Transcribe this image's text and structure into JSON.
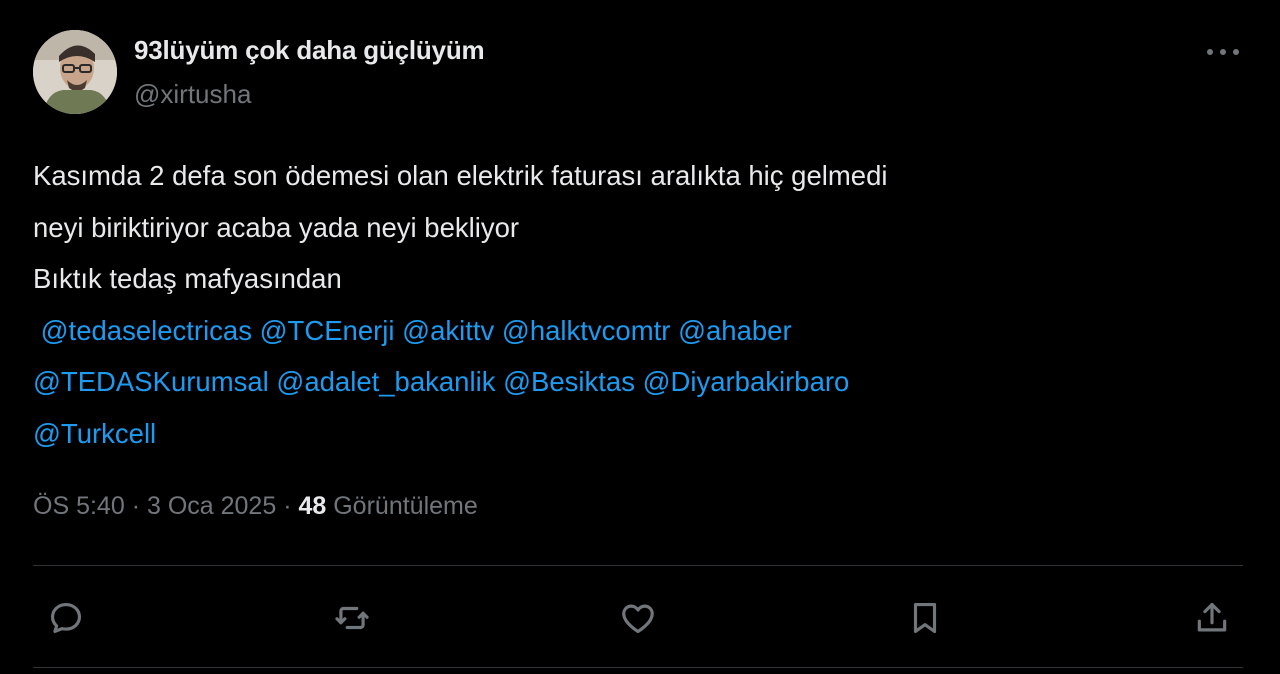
{
  "tweet": {
    "author": {
      "display_name": "93lüyüm çok daha güçlüyüm",
      "handle": "@xirtusha"
    },
    "text_lines": [
      "Kasımda 2 defa son ödemesi olan elektrik faturası aralıkta hiç gelmedi",
      "neyi biriktiriyor acaba yada neyi bekliyor",
      "Bıktık tedaş mafyasından"
    ],
    "mentions": [
      "@tedaselectricas",
      "@TCEnerji",
      "@akittv",
      "@halktvcomtr",
      "@ahaber",
      "@TEDASKurumsal",
      "@adalet_bakanlik",
      "@Besiktas",
      "@Diyarbakirbaro",
      "@Turkcell"
    ],
    "meta": {
      "time": "ÖS 5:40",
      "separator": "·",
      "date": "3 Oca 2025",
      "views_count": "48",
      "views_label": "Görüntüleme"
    },
    "actions": [
      "reply-icon",
      "retweet-icon",
      "like-icon",
      "bookmark-icon",
      "share-icon"
    ]
  },
  "colors": {
    "background": "#000000",
    "text": "#e7e9ea",
    "secondary": "#71767b",
    "link": "#1d9bf0",
    "divider": "#2f3336"
  }
}
